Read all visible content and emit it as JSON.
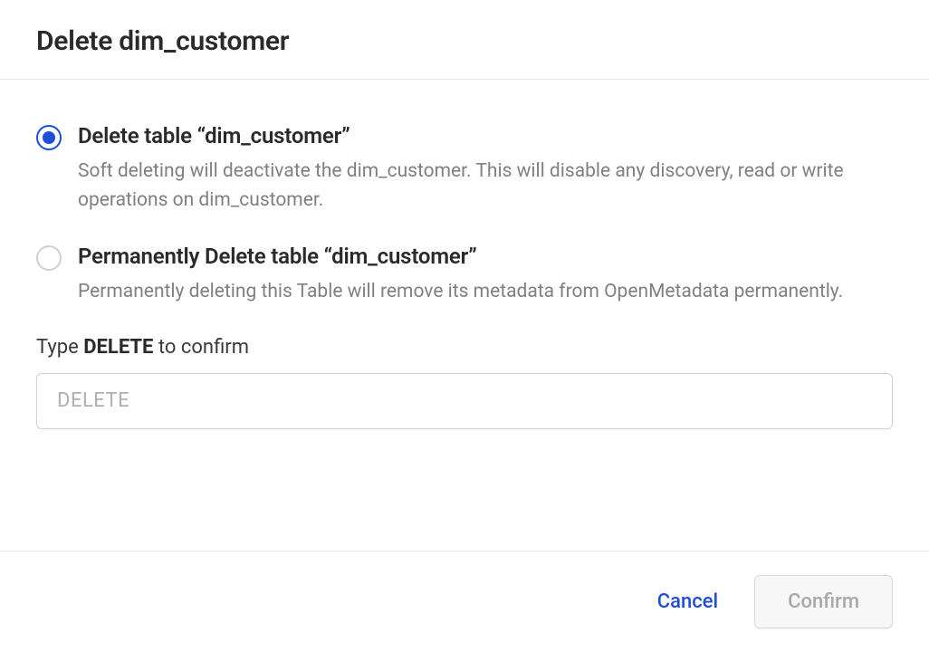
{
  "header": {
    "title": "Delete dim_customer"
  },
  "options": {
    "soft": {
      "title": "Delete table “dim_customer”",
      "description": "Soft deleting will deactivate the dim_customer. This will disable any discovery, read or write operations on dim_customer."
    },
    "hard": {
      "title": "Permanently Delete table “dim_customer”",
      "description": "Permanently deleting this Table will remove its metadata from OpenMetadata permanently."
    }
  },
  "confirm": {
    "label_prefix": "Type ",
    "label_bold": "DELETE",
    "label_suffix": " to confirm",
    "placeholder": "DELETE",
    "value": ""
  },
  "footer": {
    "cancel": "Cancel",
    "confirm": "Confirm"
  }
}
